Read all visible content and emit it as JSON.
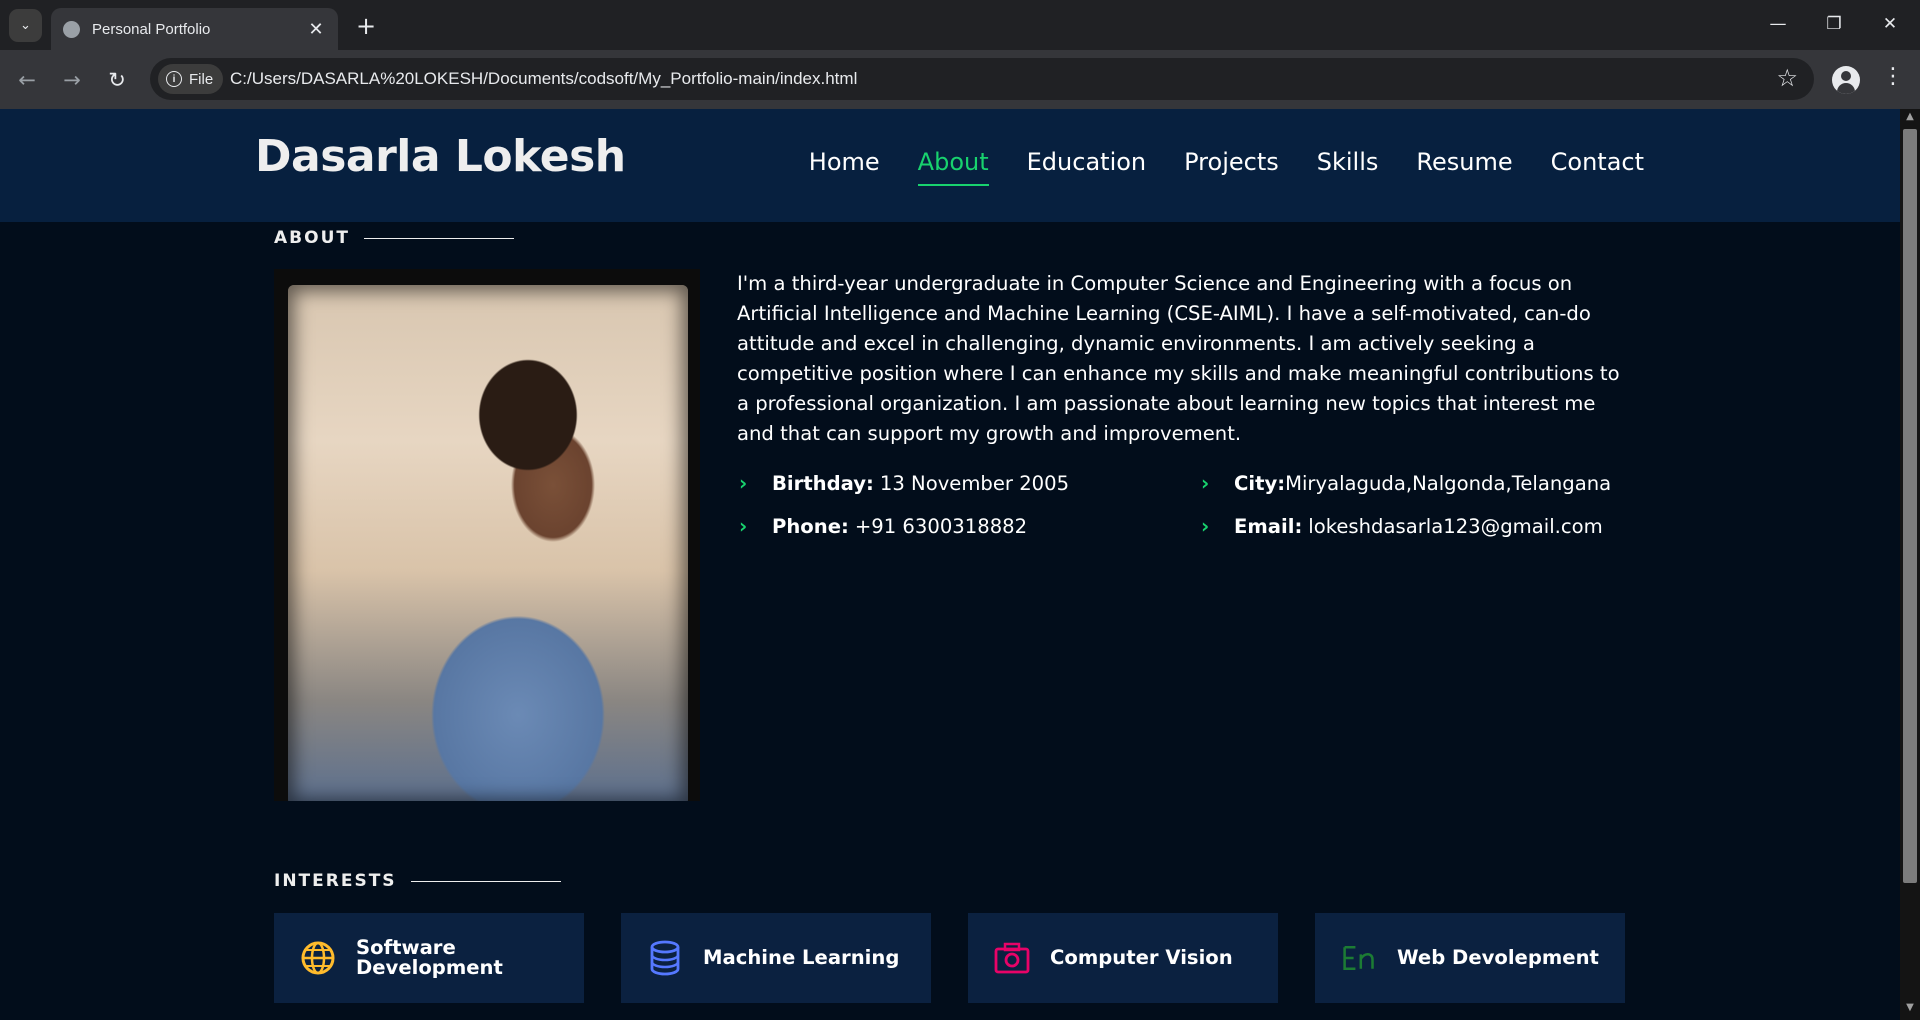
{
  "browser": {
    "tab_title": "Personal Portfolio",
    "file_chip": "File",
    "url": "C:/Users/DASARLA%20LOKESH/Documents/codsoft/My_Portfolio-main/index.html"
  },
  "site": {
    "logo": "Dasarla Lokesh",
    "nav": [
      "Home",
      "About",
      "Education",
      "Projects",
      "Skills",
      "Resume",
      "Contact"
    ],
    "active_nav": "About",
    "accent_color": "#18d26e"
  },
  "about": {
    "section_title": "ABOUT",
    "bio": "I'm a third-year undergraduate in Computer Science and Engineering with a focus on Artificial Intelligence and Machine Learning (CSE-AIML). I have a self-motivated, can-do attitude and excel in challenging, dynamic environments. I am actively seeking a competitive position where I can enhance my skills and make meaningful contributions to a professional organization. I am passionate about learning new topics that interest me and that can support my growth and improvement.",
    "details": {
      "birthday_label": "Birthday:",
      "birthday": "13 November 2005",
      "city_label": "City:",
      "city": "Miryalaguda,Nalgonda,Telangana",
      "phone_label": "Phone:",
      "phone": "+91 6300318882",
      "email_label": "Email:",
      "email": "lokeshdasarla123@gmail.com"
    }
  },
  "interests": {
    "section_title": "INTERESTS",
    "items": [
      {
        "label": "Software Development",
        "icon": "globe-icon",
        "color": "#ffbb2c"
      },
      {
        "label": "Machine Learning",
        "icon": "database-icon",
        "color": "#5578ff"
      },
      {
        "label": "Computer Vision",
        "icon": "camera-icon",
        "color": "#e80368"
      },
      {
        "label": "Web Devolepment",
        "icon": "translate-icon",
        "color": "#1c7c34"
      }
    ]
  }
}
